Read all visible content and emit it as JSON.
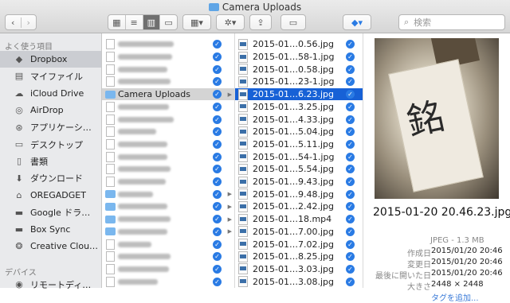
{
  "window": {
    "title": "Camera Uploads"
  },
  "toolbar": {
    "search_placeholder": "検索"
  },
  "sidebar": {
    "favorites_header": "よく使う項目",
    "items": [
      {
        "label": "Dropbox",
        "icon": "dropbox-icon"
      },
      {
        "label": "マイファイル",
        "icon": "all-files-icon"
      },
      {
        "label": "iCloud Drive",
        "icon": "cloud-icon"
      },
      {
        "label": "AirDrop",
        "icon": "airdrop-icon"
      },
      {
        "label": "アプリケーシ…",
        "icon": "applications-icon"
      },
      {
        "label": "デスクトップ",
        "icon": "desktop-icon"
      },
      {
        "label": "書類",
        "icon": "documents-icon"
      },
      {
        "label": "ダウンロード",
        "icon": "downloads-icon"
      },
      {
        "label": "OREGADGET",
        "icon": "home-icon"
      },
      {
        "label": "Google ドラ…",
        "icon": "folder-icon"
      },
      {
        "label": "Box Sync",
        "icon": "folder-icon"
      },
      {
        "label": "Creative Clou…",
        "icon": "creative-cloud-icon"
      }
    ],
    "devices_header": "デバイス",
    "device_items": [
      {
        "label": "リモートディ…",
        "icon": "disc-icon"
      }
    ]
  },
  "column2": {
    "selected_folder": "Camera Uploads"
  },
  "column3": {
    "files": [
      "2015-01…0.56.jpg",
      "2015-01…58-1.jpg",
      "2015-01…0.58.jpg",
      "2015-01…23-1.jpg",
      "2015-01…6.23.jpg",
      "2015-01…3.25.jpg",
      "2015-01…4.33.jpg",
      "2015-01…5.04.jpg",
      "2015-01…5.11.jpg",
      "2015-01…54-1.jpg",
      "2015-01…5.54.jpg",
      "2015-01…9.43.jpg",
      "2015-01…9.48.jpg",
      "2015-01…2.42.jpg",
      "2015-01…18.mp4",
      "2015-01…7.00.jpg",
      "2015-01…7.02.jpg",
      "2015-01…8.25.jpg",
      "2015-01…3.03.jpg",
      "2015-01…3.08.jpg"
    ],
    "selected_index": 4
  },
  "preview": {
    "title": "2015-01-20 20.46.23.jpg",
    "kind": "JPEG - 1.3 MB",
    "created_label": "作成日",
    "created": "2015/01/20 20:46",
    "modified_label": "変更日",
    "modified": "2015/01/20 20:46",
    "opened_label": "最後に開いた日",
    "opened": "2015/01/20 20:46",
    "size_label": "大きさ",
    "size": "2448 × 2448",
    "tag_link": "タグを追加...",
    "photo_text": "銘"
  },
  "colors": {
    "selection": "#1761d6",
    "sync": "#2a7be4",
    "sidebar": "#e9eaec"
  }
}
